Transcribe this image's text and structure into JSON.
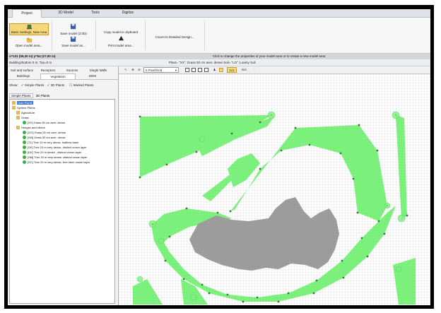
{
  "ribbon_tabs": [
    "Project",
    "3D Model",
    "Tools",
    "Digitize"
  ],
  "ribbon": {
    "basic_settings": "Basic Settings, New Area",
    "open_model": "Open model area...",
    "save_model_3d": "Save model (3.0D)",
    "save_model_as": "Save model as...",
    "copy_clipboard": "Copy model to clipboard",
    "print_model": "Print model area...",
    "convert": "Covert to Detailed Design..."
  },
  "coord_text": "x=131 (55,30 m) y=54 (27,00 m)",
  "coord_hint": "Click to change the properties of your model area or to create a new model area",
  "building_text": "Building:Bottom 0 m, Top=0 m",
  "plant_status": "Plant= \"XX\" :Grass 50 cm aver. dense  Soil= \"LO\" :Loamy Soil",
  "left_tabs_row1": [
    "Soil and surface",
    "Receptors",
    "Sources",
    "Single Walls"
  ],
  "left_tabs_row2": [
    "Buildings",
    "Vegetation",
    "DEM"
  ],
  "show": {
    "label": "Show:",
    "simple": "Simple Plants",
    "plants3d": "3D Plants",
    "marked": "Marked Plants"
  },
  "sub_tabs": [
    "Simple Plants",
    "3D Plants"
  ],
  "tree": {
    "user_plants": "User Plants",
    "system_plants": "System Plants",
    "agriculture": "Agriculture",
    "grass": "Grass",
    "grass_item": "[XX] Grass 50 cm aver. dense",
    "hedges": "Hedges and others",
    "items": [
      "[GG] Grass 50 cm aver. dense",
      "[GB] Grass 50 cm aver. dense",
      "[T1] Tree 10 m very dense, leafless base",
      "[SK] Tree 15 m very dense, distinct crown layer",
      "[DK] Tree 20 m dense , distinct crown layer",
      "[SM] Tree 20 m very dense, distinct crown layer",
      "[SC] Tree 20 m very dense, free stem crown layer"
    ]
  },
  "map_tool": {
    "zoom_select": "5 Pixel/Grid",
    "btn1": "1x1",
    "btn2": "3x3"
  },
  "colors": {
    "plant_green": "#7df27d",
    "building_gray": "#9e9e9e",
    "selected_button": "#f6d77a",
    "highlight_blue": "#3875d7"
  }
}
